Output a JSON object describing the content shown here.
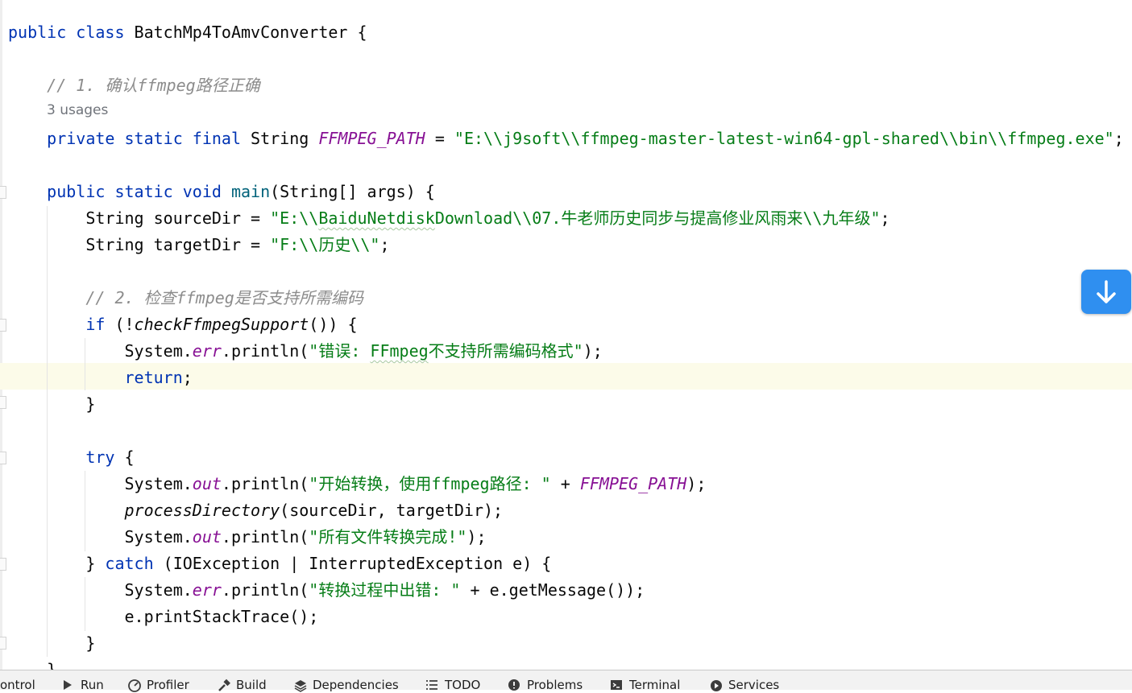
{
  "editor": {
    "usages_hint": "3 usages",
    "lines": [
      [
        {
          "t": "public class ",
          "c": "kw"
        },
        {
          "t": "BatchMp4ToAmvConverter {",
          "c": ""
        }
      ],
      [
        {
          "t": "    // 1. 确认ffmpeg路径正确",
          "c": "cm"
        }
      ],
      [
        {
          "t": "    private static final ",
          "c": "kw"
        },
        {
          "t": "String ",
          "c": ""
        },
        {
          "t": "FFMPEG_PATH",
          "c": "fld"
        },
        {
          "t": " = ",
          "c": ""
        },
        {
          "t": "\"E:\\\\j9soft\\\\ffmpeg-master-latest-win64-gpl-shared\\\\bin\\\\ffmpeg.exe\"",
          "c": "st"
        },
        {
          "t": ";",
          "c": ""
        }
      ],
      [
        {
          "t": "    public static void ",
          "c": "kw"
        },
        {
          "t": "main",
          "c": "fn"
        },
        {
          "t": "(String[] args) {",
          "c": ""
        }
      ],
      [
        {
          "t": "        String sourceDir = ",
          "c": ""
        },
        {
          "t": "\"E:\\\\",
          "c": "st"
        },
        {
          "t": "BaiduNetdisk",
          "c": "st squig"
        },
        {
          "t": "Download\\\\07.牛老师历史同步与提高修业风雨来\\\\九年级\"",
          "c": "st"
        },
        {
          "t": ";",
          "c": ""
        }
      ],
      [
        {
          "t": "        String targetDir = ",
          "c": ""
        },
        {
          "t": "\"F:\\\\历史\\\\\"",
          "c": "st"
        },
        {
          "t": ";",
          "c": ""
        }
      ],
      [
        {
          "t": "        // 2. 检查ffmpeg是否支持所需编码",
          "c": "cm"
        }
      ],
      [
        {
          "t": "        if ",
          "c": "kw"
        },
        {
          "t": "(!",
          "c": ""
        },
        {
          "t": "checkFfmpegSupport",
          "c": "sfn"
        },
        {
          "t": "()) {",
          "c": ""
        }
      ],
      [
        {
          "t": "            System.",
          "c": ""
        },
        {
          "t": "err",
          "c": "fld"
        },
        {
          "t": ".println(",
          "c": ""
        },
        {
          "t": "\"错误: ",
          "c": "st"
        },
        {
          "t": "FFmpeg",
          "c": "st squig"
        },
        {
          "t": "不支持所需编码格式\"",
          "c": "st"
        },
        {
          "t": ");",
          "c": ""
        }
      ],
      [
        {
          "t": "            return",
          "c": "kw"
        },
        {
          "t": ";",
          "c": ""
        }
      ],
      [
        {
          "t": "        }",
          "c": ""
        }
      ],
      [
        {
          "t": "        try ",
          "c": "kw"
        },
        {
          "t": "{",
          "c": ""
        }
      ],
      [
        {
          "t": "            System.",
          "c": ""
        },
        {
          "t": "out",
          "c": "fld"
        },
        {
          "t": ".println(",
          "c": ""
        },
        {
          "t": "\"开始转换，使用ffmpeg路径: \"",
          "c": "st"
        },
        {
          "t": " + ",
          "c": ""
        },
        {
          "t": "FFMPEG_PATH",
          "c": "fld"
        },
        {
          "t": ");",
          "c": ""
        }
      ],
      [
        {
          "t": "            ",
          "c": ""
        },
        {
          "t": "processDirectory",
          "c": "sfn"
        },
        {
          "t": "(sourceDir, targetDir);",
          "c": ""
        }
      ],
      [
        {
          "t": "            System.",
          "c": ""
        },
        {
          "t": "out",
          "c": "fld"
        },
        {
          "t": ".println(",
          "c": ""
        },
        {
          "t": "\"所有文件转换完成!\"",
          "c": "st"
        },
        {
          "t": ");",
          "c": ""
        }
      ],
      [
        {
          "t": "        } ",
          "c": ""
        },
        {
          "t": "catch ",
          "c": "kw"
        },
        {
          "t": "(IOException | InterruptedException e) {",
          "c": ""
        }
      ],
      [
        {
          "t": "            System.",
          "c": ""
        },
        {
          "t": "err",
          "c": "fld"
        },
        {
          "t": ".println(",
          "c": ""
        },
        {
          "t": "\"转换过程中出错: \"",
          "c": "st"
        },
        {
          "t": " + e.getMessage());",
          "c": ""
        }
      ],
      [
        {
          "t": "            e.printStackTrace();",
          "c": ""
        }
      ],
      [
        {
          "t": "        }",
          "c": ""
        }
      ],
      [
        {
          "t": "    }",
          "c": ""
        }
      ]
    ]
  },
  "scroll_button": {
    "icon": "arrow-down-icon"
  },
  "toolbar": {
    "items": [
      {
        "label": "ontrol",
        "icon": ""
      },
      {
        "label": "Run",
        "icon": "run-icon"
      },
      {
        "label": "Profiler",
        "icon": "profiler-icon"
      },
      {
        "label": "Build",
        "icon": "build-icon"
      },
      {
        "label": "Dependencies",
        "icon": "dependencies-icon"
      },
      {
        "label": "TODO",
        "icon": "todo-icon"
      },
      {
        "label": "Problems",
        "icon": "problems-icon"
      },
      {
        "label": "Terminal",
        "icon": "terminal-icon"
      },
      {
        "label": "Services",
        "icon": "services-icon"
      }
    ]
  }
}
